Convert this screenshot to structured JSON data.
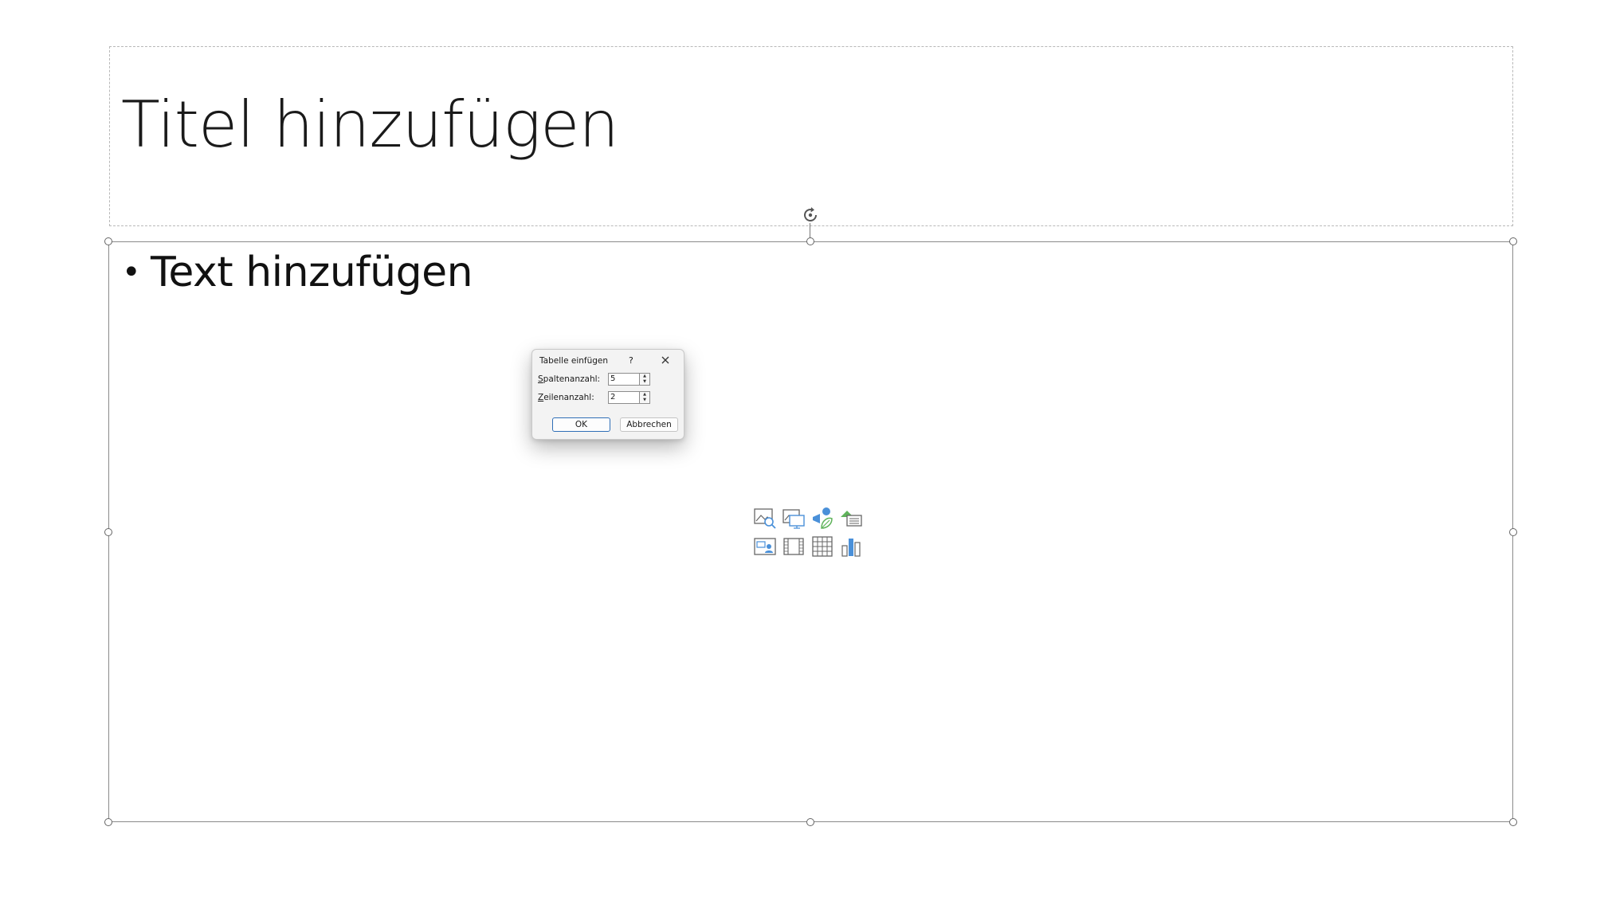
{
  "slide": {
    "title_placeholder": "Titel hinzufügen",
    "content_placeholder": "Text hinzufügen"
  },
  "content_icons": [
    "stock-images-icon",
    "pictures-icon",
    "icons-insert-icon",
    "smartart-icon",
    "cameo-icon",
    "video-icon",
    "table-icon",
    "chart-icon"
  ],
  "dialog": {
    "title": "Tabelle einfügen",
    "help": "?",
    "columns_label_mnemonic": "S",
    "columns_label_rest": "paltenanzahl:",
    "columns_value": "5",
    "rows_label_mnemonic": "Z",
    "rows_label_rest": "eilenanzahl:",
    "rows_value": "2",
    "ok_label": "OK",
    "cancel_label": "Abbrechen"
  },
  "colors": {
    "ok_border": "#2f6fb7",
    "icon_blue": "#4a90d9",
    "icon_green": "#5fb35a"
  }
}
